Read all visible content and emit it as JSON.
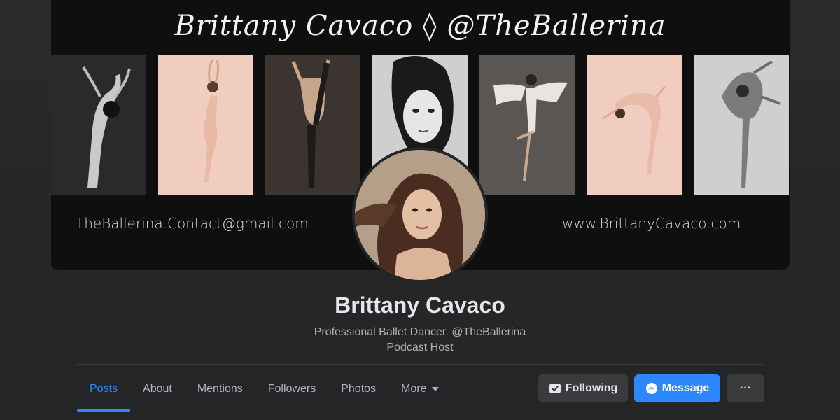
{
  "cover": {
    "title": "Brittany Cavaco ◊ @TheBallerina",
    "email": "TheBallerina.Contact@gmail.com",
    "website": "www.BrittanyCavaco.com"
  },
  "profile": {
    "name": "Brittany Cavaco",
    "bio_line1": "Professional Ballet Dancer. @TheBallerina",
    "bio_line2": "Podcast Host"
  },
  "tabs": [
    {
      "label": "Posts",
      "active": true
    },
    {
      "label": "About"
    },
    {
      "label": "Mentions"
    },
    {
      "label": "Followers"
    },
    {
      "label": "Photos"
    },
    {
      "label": "More"
    }
  ],
  "actions": {
    "following_label": "Following",
    "message_label": "Message",
    "more_label": "···"
  },
  "colors": {
    "accent": "#2d88ff",
    "background": "#242526",
    "button_secondary": "#3a3b3c"
  },
  "icons": {
    "following": "following-check-icon",
    "message": "messenger-icon",
    "more_caret": "chevron-down-icon"
  }
}
